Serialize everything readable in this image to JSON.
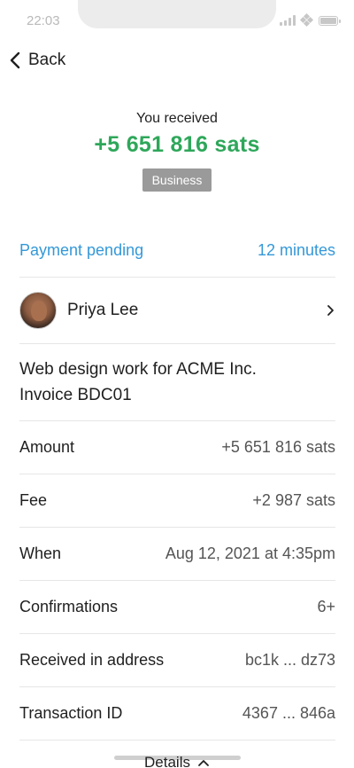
{
  "status_bar": {
    "time": "22:03"
  },
  "nav": {
    "back_label": "Back"
  },
  "header": {
    "caption": "You received",
    "amount": "+5 651 816 sats",
    "tag": "Business"
  },
  "pending": {
    "label": "Payment pending",
    "time": "12 minutes"
  },
  "contact": {
    "name": "Priya Lee"
  },
  "memo": "Web design work for ACME Inc.\nInvoice BDC01",
  "details": [
    {
      "label": "Amount",
      "value": "+5 651 816 sats"
    },
    {
      "label": "Fee",
      "value": "+2 987 sats"
    },
    {
      "label": "When",
      "value": "Aug 12, 2021 at 4:35pm"
    },
    {
      "label": "Confirmations",
      "value": "6+"
    },
    {
      "label": "Received in address",
      "value": "bc1k ... dz73"
    },
    {
      "label": "Transaction ID",
      "value": "4367 ... 846a"
    }
  ],
  "footer": {
    "details_label": "Details"
  },
  "colors": {
    "accent_green": "#2ea75a",
    "accent_blue": "#3498d8",
    "badge_gray": "#9a9a9a"
  }
}
